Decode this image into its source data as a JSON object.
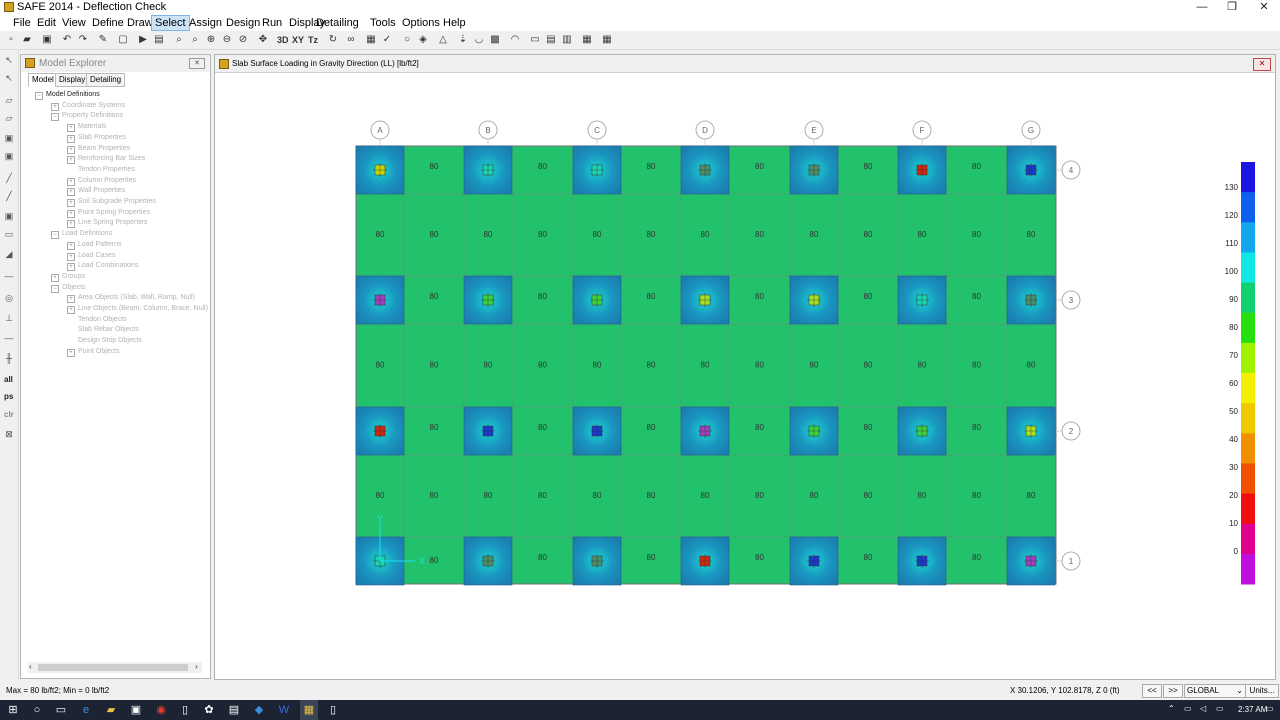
{
  "window": {
    "title": "SAFE 2014 - Deflection Check",
    "minimize": "—",
    "restore": "❐",
    "close": "✕"
  },
  "menu": [
    "File",
    "Edit",
    "View",
    "Define",
    "Draw",
    "Select",
    "Assign",
    "Design",
    "Run",
    "Display",
    "Detailing",
    "Tools",
    "Options",
    "Help"
  ],
  "menu_active": "Select",
  "toolbar": {
    "icons": [
      "new-icon",
      "open-icon",
      "save-icon",
      "undo-icon",
      "redo-icon",
      "pencil-icon",
      "lock-icon",
      "run-icon",
      "run-all-icon",
      "zoom-rect-icon",
      "zoom-all-icon",
      "zoom-in-icon",
      "zoom-out-icon",
      "zoom-prev-icon",
      "pan-icon"
    ],
    "view_3d": "3D",
    "view_xy": "XY",
    "view_tz": "Tz"
  },
  "left_tools_text": [
    "all",
    "ps",
    "clr"
  ],
  "explorer": {
    "title": "Model Explorer",
    "tabs": [
      "Model",
      "Display",
      "Detailing"
    ],
    "active_tab": "Model",
    "tree": [
      {
        "label": "Model Definitions",
        "level": 0,
        "toggle": "−",
        "root": true
      },
      {
        "label": "Coordinate Systems",
        "level": 1,
        "toggle": "+"
      },
      {
        "label": "Property Definitions",
        "level": 1,
        "toggle": "−"
      },
      {
        "label": "Materials",
        "level": 2,
        "toggle": "+"
      },
      {
        "label": "Slab Properties",
        "level": 2,
        "toggle": "+"
      },
      {
        "label": "Beam Properties",
        "level": 2,
        "toggle": "+"
      },
      {
        "label": "Reinforcing Bar Sizes",
        "level": 2,
        "toggle": "+"
      },
      {
        "label": "Tendon Properties",
        "level": 2,
        "toggle": ""
      },
      {
        "label": "Column Properties",
        "level": 2,
        "toggle": "+"
      },
      {
        "label": "Wall Properties",
        "level": 2,
        "toggle": "+"
      },
      {
        "label": "Soil Subgrade Properties",
        "level": 2,
        "toggle": "+"
      },
      {
        "label": "Point Spring Properties",
        "level": 2,
        "toggle": "+"
      },
      {
        "label": "Line Spring Properties",
        "level": 2,
        "toggle": "+"
      },
      {
        "label": "Load Definitions",
        "level": 1,
        "toggle": "−"
      },
      {
        "label": "Load Patterns",
        "level": 2,
        "toggle": "+"
      },
      {
        "label": "Load Cases",
        "level": 2,
        "toggle": "+"
      },
      {
        "label": "Load Combinations",
        "level": 2,
        "toggle": "+"
      },
      {
        "label": "Groups",
        "level": 1,
        "toggle": "+"
      },
      {
        "label": "Objects",
        "level": 1,
        "toggle": "−"
      },
      {
        "label": "Area Objects (Slab, Wall, Ramp, Null)",
        "level": 2,
        "toggle": "+"
      },
      {
        "label": "Line Objects (Beam, Column, Brace, Null)",
        "level": 2,
        "toggle": "+"
      },
      {
        "label": "Tendon Objects",
        "level": 2,
        "toggle": ""
      },
      {
        "label": "Slab Rebar Objects",
        "level": 2,
        "toggle": ""
      },
      {
        "label": "Design Strip Objects",
        "level": 2,
        "toggle": ""
      },
      {
        "label": "Point Objects",
        "level": 2,
        "toggle": "+"
      }
    ]
  },
  "view": {
    "title": "Slab Surface Loading in Gravity Direction (LL)  [lb/ft2]",
    "grid_cols": [
      "A",
      "B",
      "C",
      "D",
      "E",
      "F",
      "G"
    ],
    "grid_rows": [
      "4",
      "3",
      "2",
      "1"
    ],
    "slab_value": "80",
    "axis_x": "X",
    "axis_y": "Y",
    "colors": {
      "slab": "#21c26b",
      "column_region": "#1a7fb0",
      "slab_edge": "#6f6f6f"
    },
    "column_markers": [
      [
        "#c8d400",
        "#19d6b0",
        "#19d6b0",
        "#4a8f6a",
        "#4a8f6a",
        "#d02810",
        "#1a3acc"
      ],
      [
        "#a040c0",
        "#3cd23c",
        "#3cd23c",
        "#a8e020",
        "#a8e020",
        "#19d6b0",
        "#4a8f6a"
      ],
      [
        "#d02810",
        "#1a3acc",
        "#1a3acc",
        "#a040c0",
        "#3cd23c",
        "#3cd23c",
        "#a8e020"
      ],
      [
        "#19d6b0",
        "#4a8f6a",
        "#4a8f6a",
        "#d02810",
        "#1a3acc",
        "#1a3acc",
        "#a040c0"
      ]
    ]
  },
  "legend": {
    "ticks": [
      "130",
      "120",
      "110",
      "100",
      "90",
      "80",
      "70",
      "60",
      "50",
      "40",
      "30",
      "20",
      "10",
      "0"
    ],
    "gradient": [
      "#1a14e0",
      "#1060f0",
      "#12a8f0",
      "#10e8e8",
      "#10d070",
      "#28e010",
      "#a0f000",
      "#f0f000",
      "#f0c800",
      "#f09000",
      "#f05000",
      "#f01010",
      "#e00090",
      "#c010e0"
    ]
  },
  "status": {
    "left": "Max = 80 lb/ft2;  Min = 0 lb/ft2",
    "coords": "X 30.1206,  Y 102.8178,  Z 0  (ft)",
    "prev": "<<",
    "next": ">>",
    "coord_system": "GLOBAL",
    "units": "Units..."
  },
  "taskbar": {
    "time": "2:37 AM"
  }
}
